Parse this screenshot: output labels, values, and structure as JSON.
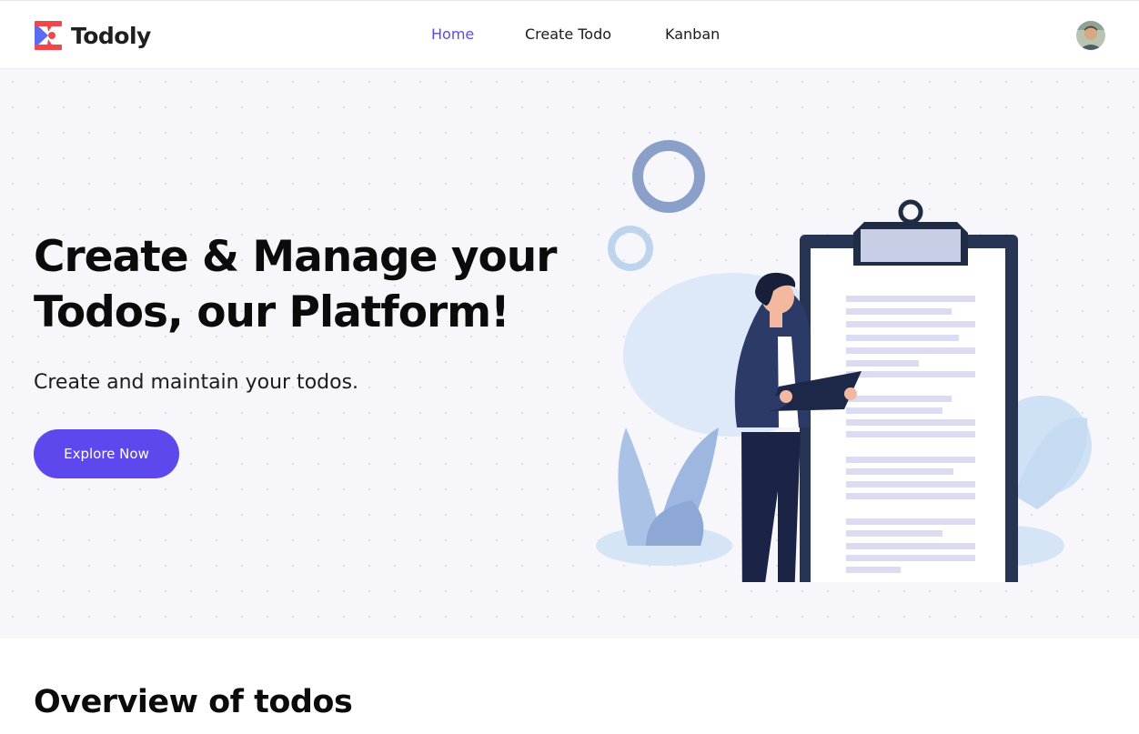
{
  "brand": {
    "name": "Todoly",
    "colors": {
      "blue": "#5b6cf2",
      "red": "#f0474f"
    }
  },
  "nav": {
    "items": [
      {
        "label": "Home",
        "active": true
      },
      {
        "label": "Create Todo",
        "active": false
      },
      {
        "label": "Kanban",
        "active": false
      }
    ],
    "active_color": "#5b4ae8"
  },
  "user": {
    "avatar_icon": "user-avatar"
  },
  "hero": {
    "title_line1": "Create & Manage your",
    "title_line2": "Todos, our Platform!",
    "subtitle": "Create and maintain your todos.",
    "cta_label": "Explore Now",
    "cta_color": "#5c48ec",
    "illustration": "person-with-clipboard-illustration"
  },
  "overview": {
    "title": "Overview of todos"
  }
}
